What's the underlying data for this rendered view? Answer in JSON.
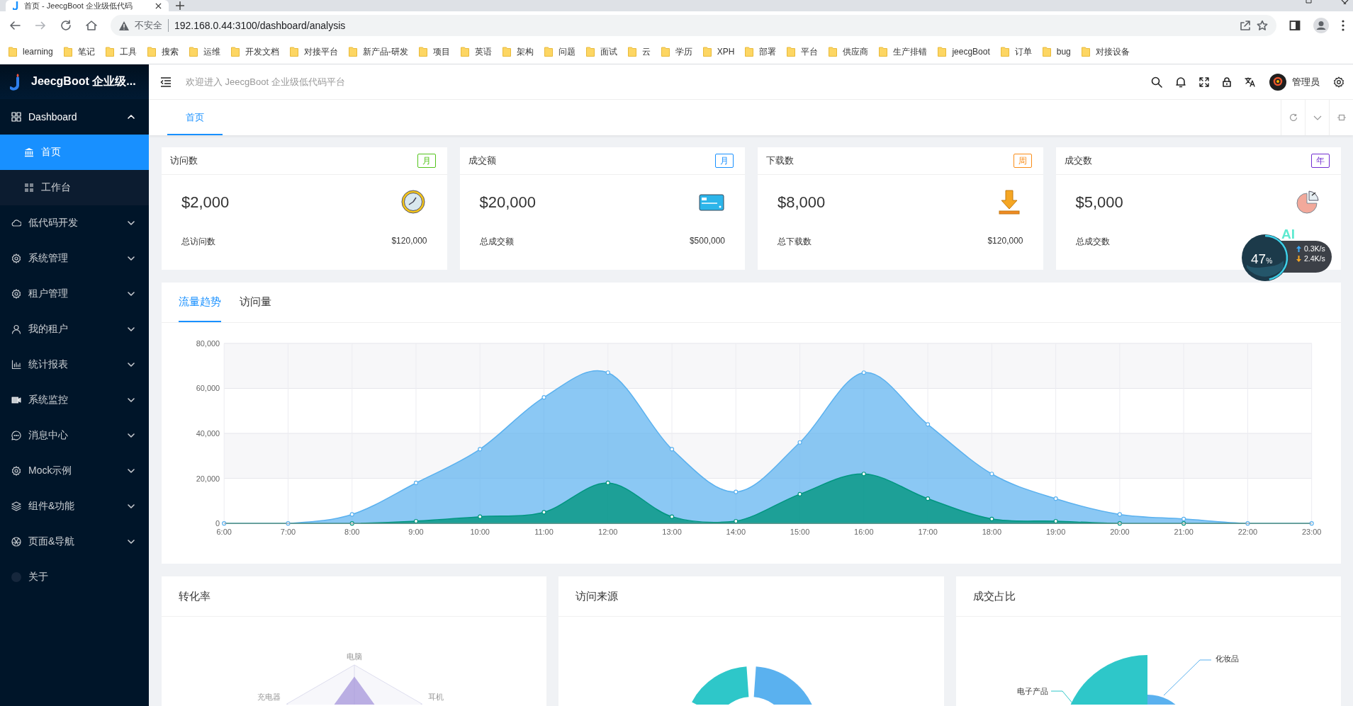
{
  "browser": {
    "tab_title": "首页 - JeecgBoot 企业级低代码",
    "security_label": "不安全",
    "url": "192.168.0.44:3100/dashboard/analysis",
    "bookmarks": [
      "learning",
      "笔记",
      "工具",
      "搜索",
      "运维",
      "开发文档",
      "对接平台",
      "新产品-研发",
      "项目",
      "英语",
      "架构",
      "问题",
      "面试",
      "云",
      "学历",
      "XPH",
      "部署",
      "平台",
      "供应商",
      "生产排错",
      "jeecgBoot",
      "订单",
      "bug",
      "对接设备"
    ]
  },
  "sidebar": {
    "logo_text": "JeecgBoot 企业级...",
    "items": [
      {
        "label": "Dashboard",
        "kind": "group",
        "expanded": true,
        "children": [
          {
            "label": "首页",
            "selected": true
          },
          {
            "label": "工作台",
            "selected": false
          }
        ]
      },
      {
        "label": "低代码开发",
        "kind": "group",
        "expanded": false
      },
      {
        "label": "系统管理",
        "kind": "group",
        "expanded": false
      },
      {
        "label": "租户管理",
        "kind": "group",
        "expanded": false
      },
      {
        "label": "我的租户",
        "kind": "group",
        "expanded": false
      },
      {
        "label": "统计报表",
        "kind": "group",
        "expanded": false
      },
      {
        "label": "系统监控",
        "kind": "group",
        "expanded": false
      },
      {
        "label": "消息中心",
        "kind": "group",
        "expanded": false
      },
      {
        "label": "Mock示例",
        "kind": "group",
        "expanded": false
      },
      {
        "label": "组件&功能",
        "kind": "group",
        "expanded": false
      },
      {
        "label": "页面&导航",
        "kind": "group",
        "expanded": false
      },
      {
        "label": "关于",
        "kind": "link"
      }
    ]
  },
  "header": {
    "welcome": "欢迎进入 JeecgBoot 企业级低代码平台",
    "user": "管理员"
  },
  "page_tabs": [
    {
      "label": "首页",
      "selected": true
    }
  ],
  "stat_cards": [
    {
      "title": "访问数",
      "tag": "月",
      "color": "#52c41a",
      "value": "$2,000",
      "footer_label": "总访问数",
      "footer_value": "$120,000"
    },
    {
      "title": "成交额",
      "tag": "月",
      "color": "#1890ff",
      "value": "$20,000",
      "footer_label": "总成交额",
      "footer_value": "$500,000"
    },
    {
      "title": "下载数",
      "tag": "周",
      "color": "#fa8c16",
      "value": "$8,000",
      "footer_label": "总下载数",
      "footer_value": "$120,000"
    },
    {
      "title": "成交数",
      "tag": "年",
      "color": "#722ed1",
      "value": "$5,000",
      "footer_label": "总成交数"
    }
  ],
  "network_widget": {
    "badge": "AI",
    "percent": "47",
    "unit": "%",
    "level": 0.47,
    "upload": "0.3K/s",
    "download": "2.4K/s"
  },
  "traffic_panel": {
    "tabs": [
      {
        "label": "流量趋势",
        "selected": true
      },
      {
        "label": "访问量",
        "selected": false
      }
    ],
    "chart_data": {
      "type": "area",
      "categories": [
        "6:00",
        "7:00",
        "8:00",
        "9:00",
        "10:00",
        "11:00",
        "12:00",
        "13:00",
        "14:00",
        "15:00",
        "16:00",
        "17:00",
        "18:00",
        "19:00",
        "20:00",
        "21:00",
        "22:00",
        "23:00"
      ],
      "series": [
        {
          "color": "#5ab1ef",
          "values": [
            0,
            0,
            4000,
            18000,
            33000,
            56000,
            67000,
            33000,
            14000,
            36000,
            67000,
            44000,
            22000,
            11000,
            4000,
            2000,
            0,
            0
          ]
        },
        {
          "color": "#019680",
          "values": [
            0,
            0,
            0,
            1000,
            3000,
            5000,
            18000,
            3000,
            1000,
            13000,
            22000,
            11000,
            2000,
            1000,
            0,
            0,
            0,
            0
          ]
        }
      ],
      "grid": true,
      "ylim": [
        0,
        80000
      ],
      "yticks": [
        {
          "value": 0,
          "label": "0"
        },
        {
          "value": 20000,
          "label": "20,000"
        },
        {
          "value": 40000,
          "label": "40,000"
        },
        {
          "value": 60000,
          "label": "60,000"
        },
        {
          "value": 80000,
          "label": "80,000"
        }
      ]
    }
  },
  "bottom_panels": [
    {
      "title": "转化率",
      "kind": "radar",
      "labels": [
        "电脑",
        "充电器",
        "耳机"
      ]
    },
    {
      "title": "访问来源",
      "kind": "donut"
    },
    {
      "title": "成交占比",
      "kind": "pie",
      "labels": [
        "化妆品",
        "电子产品"
      ]
    }
  ]
}
